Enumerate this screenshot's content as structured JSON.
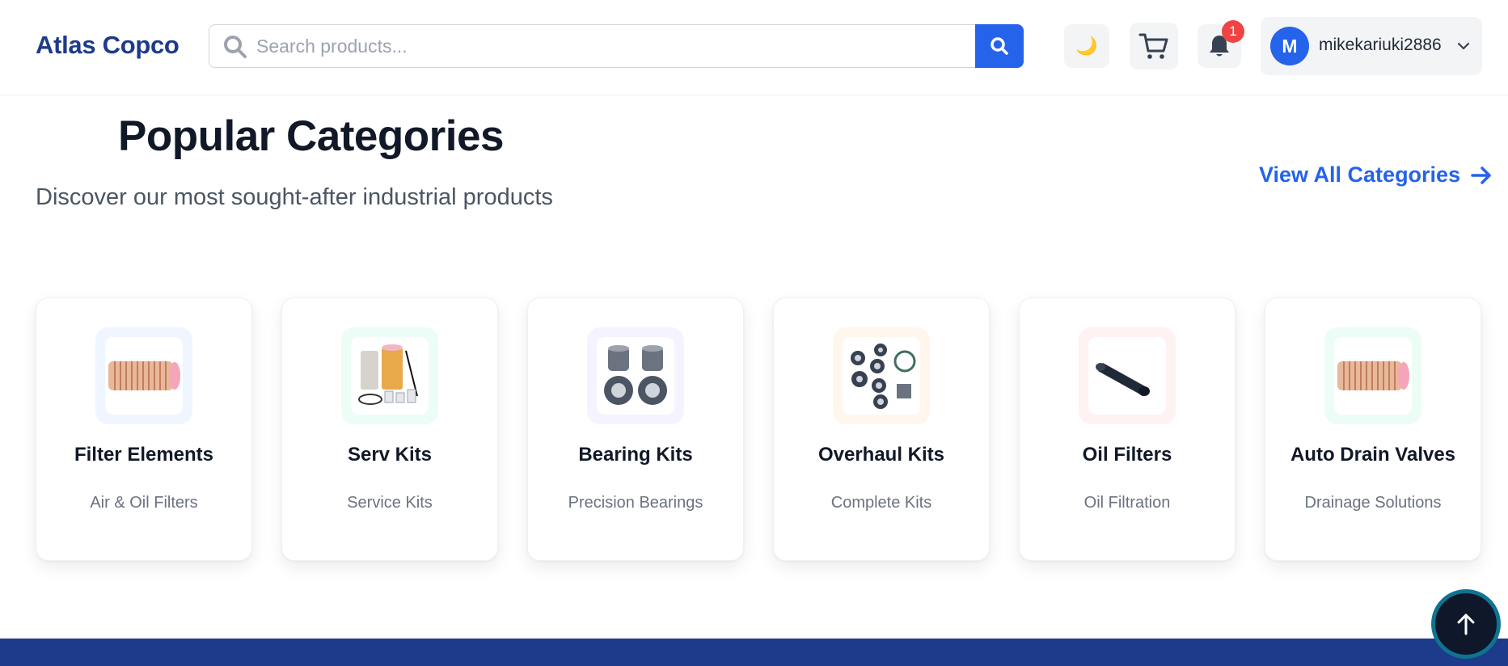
{
  "header": {
    "brand": "Atlas Copco",
    "search_placeholder": "Search products...",
    "theme_icon": "moon-icon",
    "notification_count": "1",
    "user": {
      "initial": "M",
      "name": "mikekariuki2886"
    }
  },
  "section": {
    "title": "Popular Categories",
    "subtitle": "Discover our most sought-after industrial products",
    "view_all": "View All Categories"
  },
  "categories": [
    {
      "title": "Filter Elements",
      "subtitle": "Air & Oil Filters",
      "bg": "#eff6ff",
      "icon": "pleated-filter-image"
    },
    {
      "title": "Serv Kits",
      "subtitle": "Service Kits",
      "bg": "#ecfdf5",
      "icon": "service-kit-image"
    },
    {
      "title": "Bearing Kits",
      "subtitle": "Precision Bearings",
      "bg": "#f5f3ff",
      "icon": "bearing-kit-image"
    },
    {
      "title": "Overhaul Kits",
      "subtitle": "Complete Kits",
      "bg": "#fff7ed",
      "icon": "overhaul-kit-image"
    },
    {
      "title": "Oil Filters",
      "subtitle": "Oil Filtration",
      "bg": "#fef2f2",
      "icon": "oil-filter-image"
    },
    {
      "title": "Auto Drain Valves",
      "subtitle": "Drainage Solutions",
      "bg": "#ecfdf5",
      "icon": "pleated-filter-image"
    }
  ],
  "colors": {
    "brand": "#1e3a8a",
    "accent": "#2563eb",
    "badge": "#ef4444"
  }
}
